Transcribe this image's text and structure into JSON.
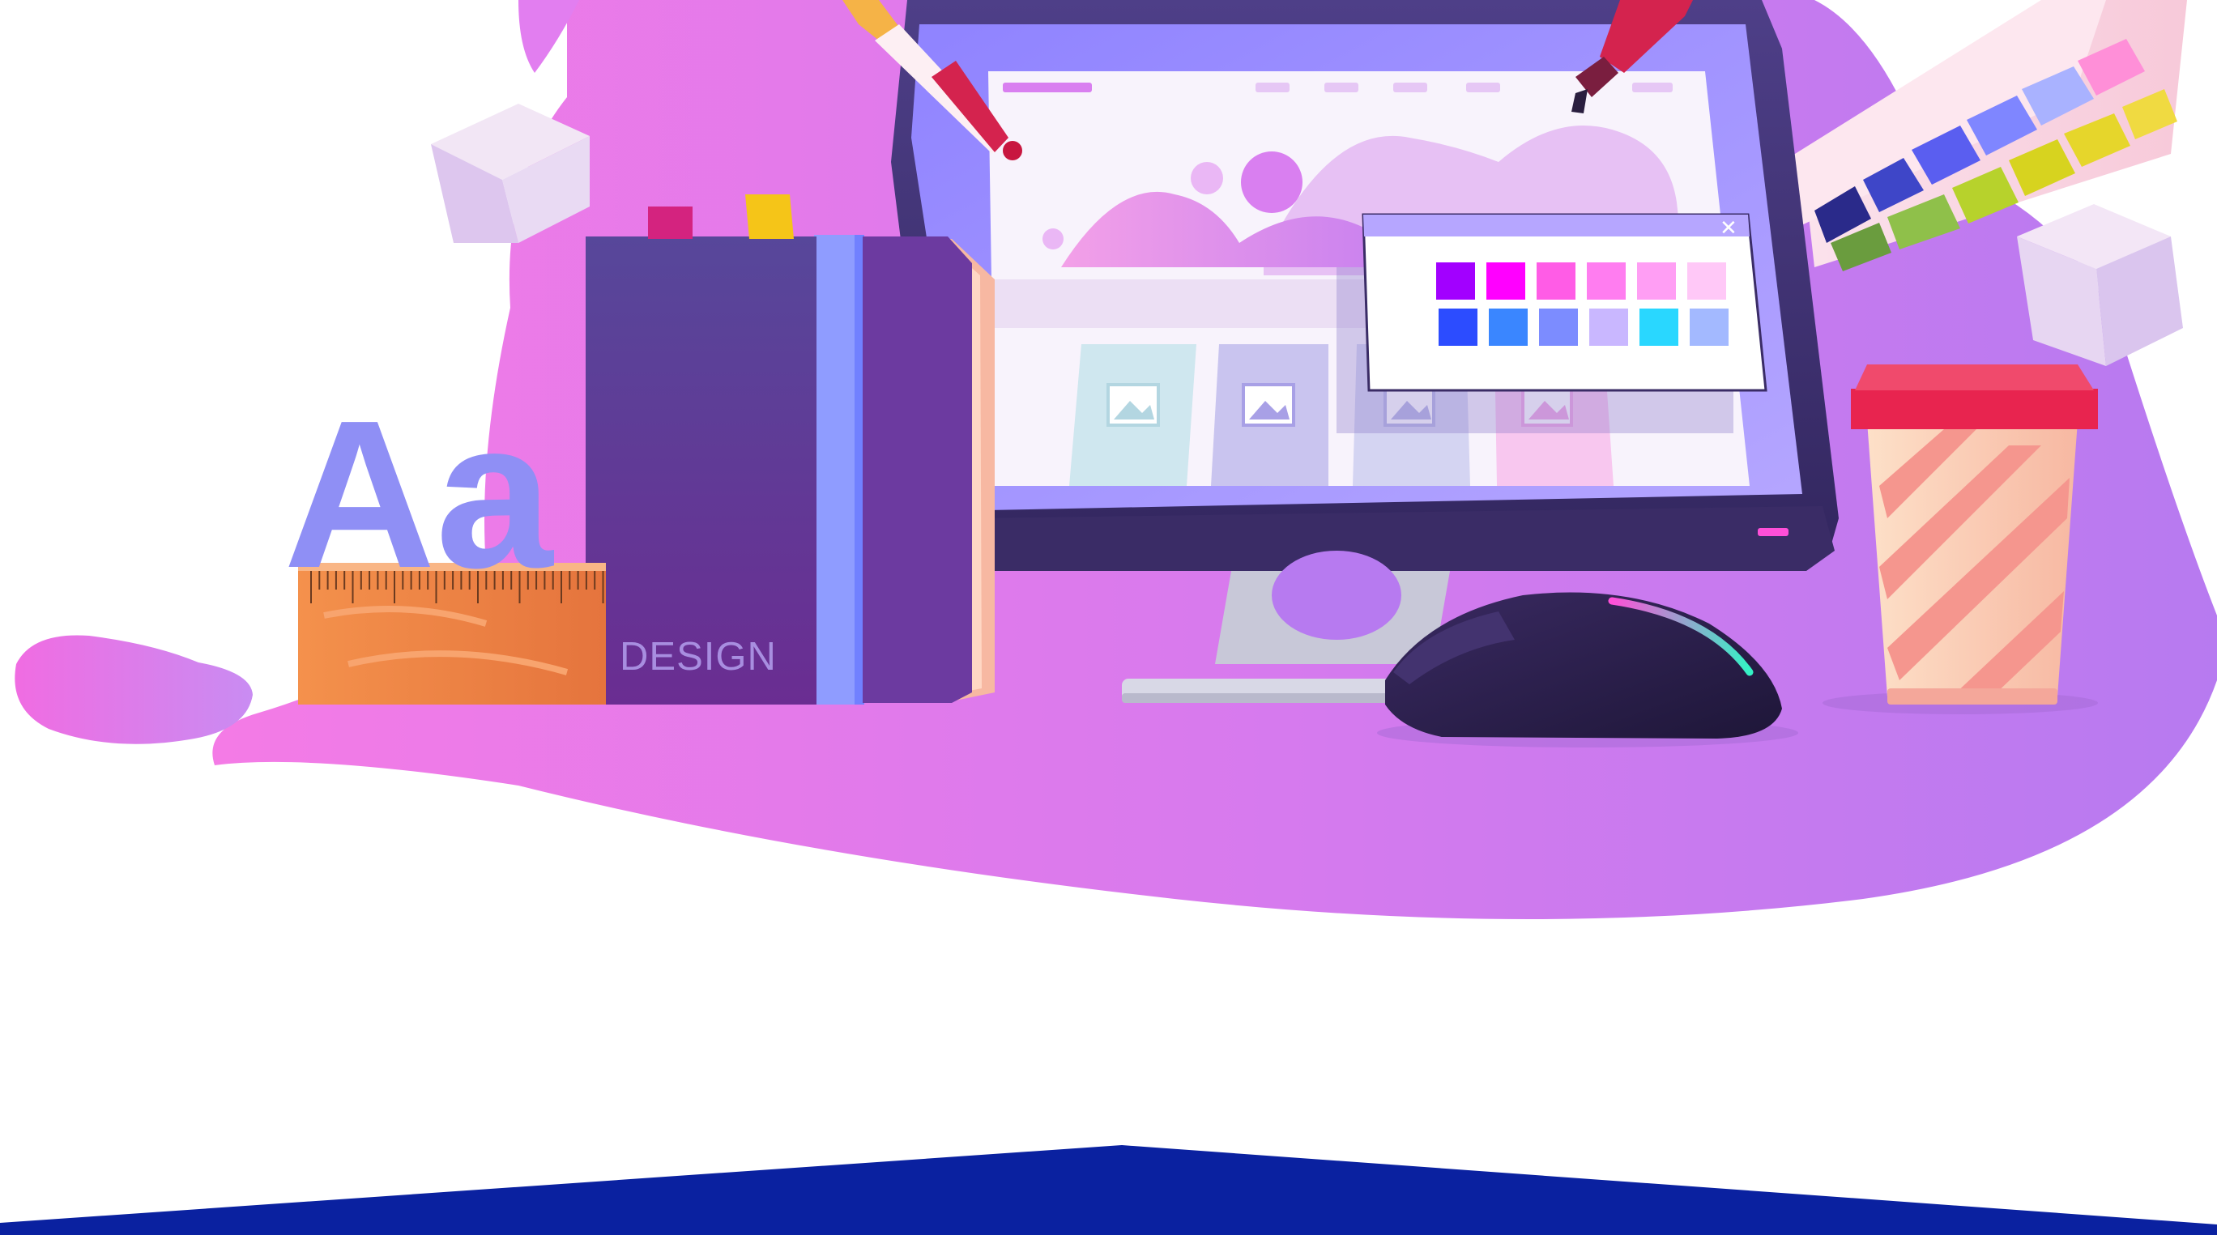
{
  "illustration": {
    "book_label": "DESIGN",
    "type_specimen": "Aa",
    "color_picker_close_glyph": "✕"
  },
  "colors": {
    "background": "#ffffff",
    "blob_left": "#f47be6",
    "blob_right": "#b77af0",
    "footer_band": "#0a21a0",
    "book_cover": "#5b3f9c",
    "ruler": "#f08a4b",
    "mouse": "#2c1f4e",
    "cup_lid": "#e8244f"
  },
  "palette_swatches": {
    "top_row": [
      "#a200ff",
      "#ff00ff",
      "#ff5ce6",
      "#ff7df0",
      "#ff9ef4",
      "#ffc8f7"
    ],
    "bottom_row": [
      "#2c4cff",
      "#3a86ff",
      "#7c8cff",
      "#c9b7ff",
      "#29d7ff",
      "#a3b9ff"
    ]
  },
  "icons": [
    "pen-tool-icon",
    "color-dropper-icon",
    "close-icon",
    "image-placeholder-icon"
  ]
}
